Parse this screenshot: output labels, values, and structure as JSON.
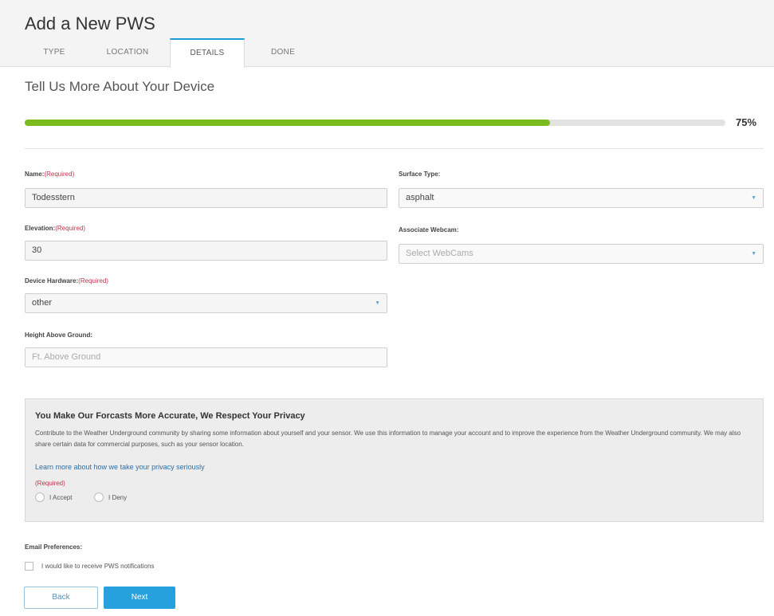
{
  "header": {
    "title": "Add a New PWS",
    "tabs": [
      {
        "label": "TYPE",
        "active": false
      },
      {
        "label": "LOCATION",
        "active": false
      },
      {
        "label": "DETAILS",
        "active": true
      },
      {
        "label": "DONE",
        "active": false
      }
    ]
  },
  "section": {
    "title": "Tell Us More About Your Device"
  },
  "progress": {
    "value": 0.75,
    "label": "75%",
    "color": "#7cbb1f"
  },
  "form": {
    "name": {
      "label": "Name:",
      "required": "(Required)",
      "value": "Todesstern"
    },
    "elevation": {
      "label": "Elevation:",
      "required": "(Required)",
      "value": "30"
    },
    "device_hardware": {
      "label": "Device Hardware:",
      "required": "(Required)",
      "value": "other"
    },
    "height_above_ground": {
      "label": "Height Above Ground:",
      "placeholder": "Ft. Above Ground"
    },
    "surface_type": {
      "label": "Surface Type:",
      "value": "asphalt"
    },
    "associate_webcam": {
      "label": "Associate Webcam:",
      "placeholder": "Select WebCams"
    }
  },
  "privacy": {
    "title": "You Make Our Forcasts More Accurate, We Respect Your Privacy",
    "text": "Contribute to the Weather Underground community by sharing some information about yourself and your sensor. We use this information to manage your account and to improve the experience from the Weather Underground community. We may also share certain data for commercial purposes, such as your sensor location.",
    "link": "Learn more about how we take your privacy seriously",
    "required": "(Required)",
    "accept_label": "I Accept",
    "deny_label": "I Deny"
  },
  "email": {
    "label": "Email Preferences:",
    "checkbox_label": "I would like to receive PWS notifications"
  },
  "buttons": {
    "back": "Back",
    "next": "Next"
  },
  "colors": {
    "accent": "#27a0de",
    "required": "#c0334a",
    "progress": "#7cbb1f"
  }
}
